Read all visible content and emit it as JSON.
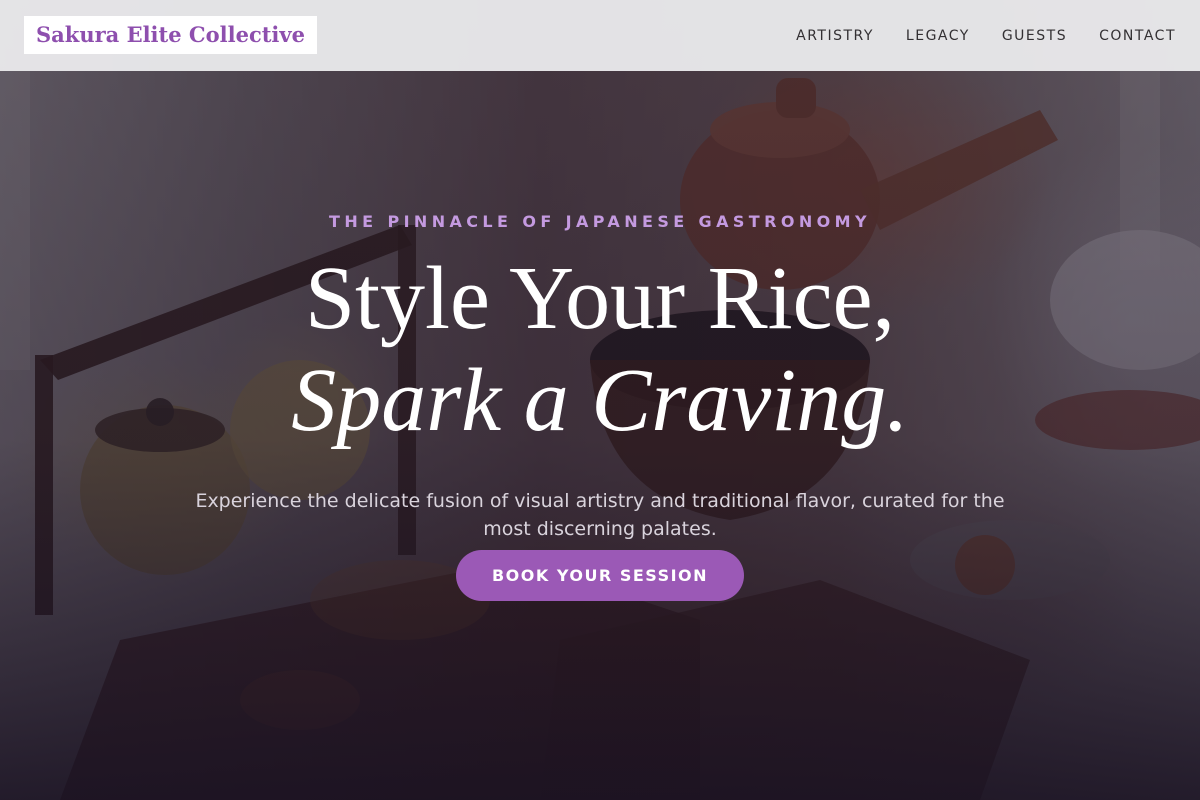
{
  "header": {
    "logo": "Sakura Elite Collective",
    "nav": [
      {
        "label": "ARTISTRY"
      },
      {
        "label": "LEGACY"
      },
      {
        "label": "GUESTS"
      },
      {
        "label": "CONTACT"
      }
    ]
  },
  "hero": {
    "eyebrow": "THE PINNACLE OF JAPANESE GASTRONOMY",
    "headline_line1": "Style Your Rice,",
    "headline_line2": "Spark a Craving.",
    "subtext": "Experience the delicate fusion of visual artistry and traditional flavor, curated for the most discerning palates.",
    "cta_label": "BOOK YOUR SESSION"
  },
  "colors": {
    "accent": "#9b59b6",
    "eyebrow": "#c49ae0",
    "logo": "#8e4fae",
    "header_bg": "#e8e8ea"
  }
}
